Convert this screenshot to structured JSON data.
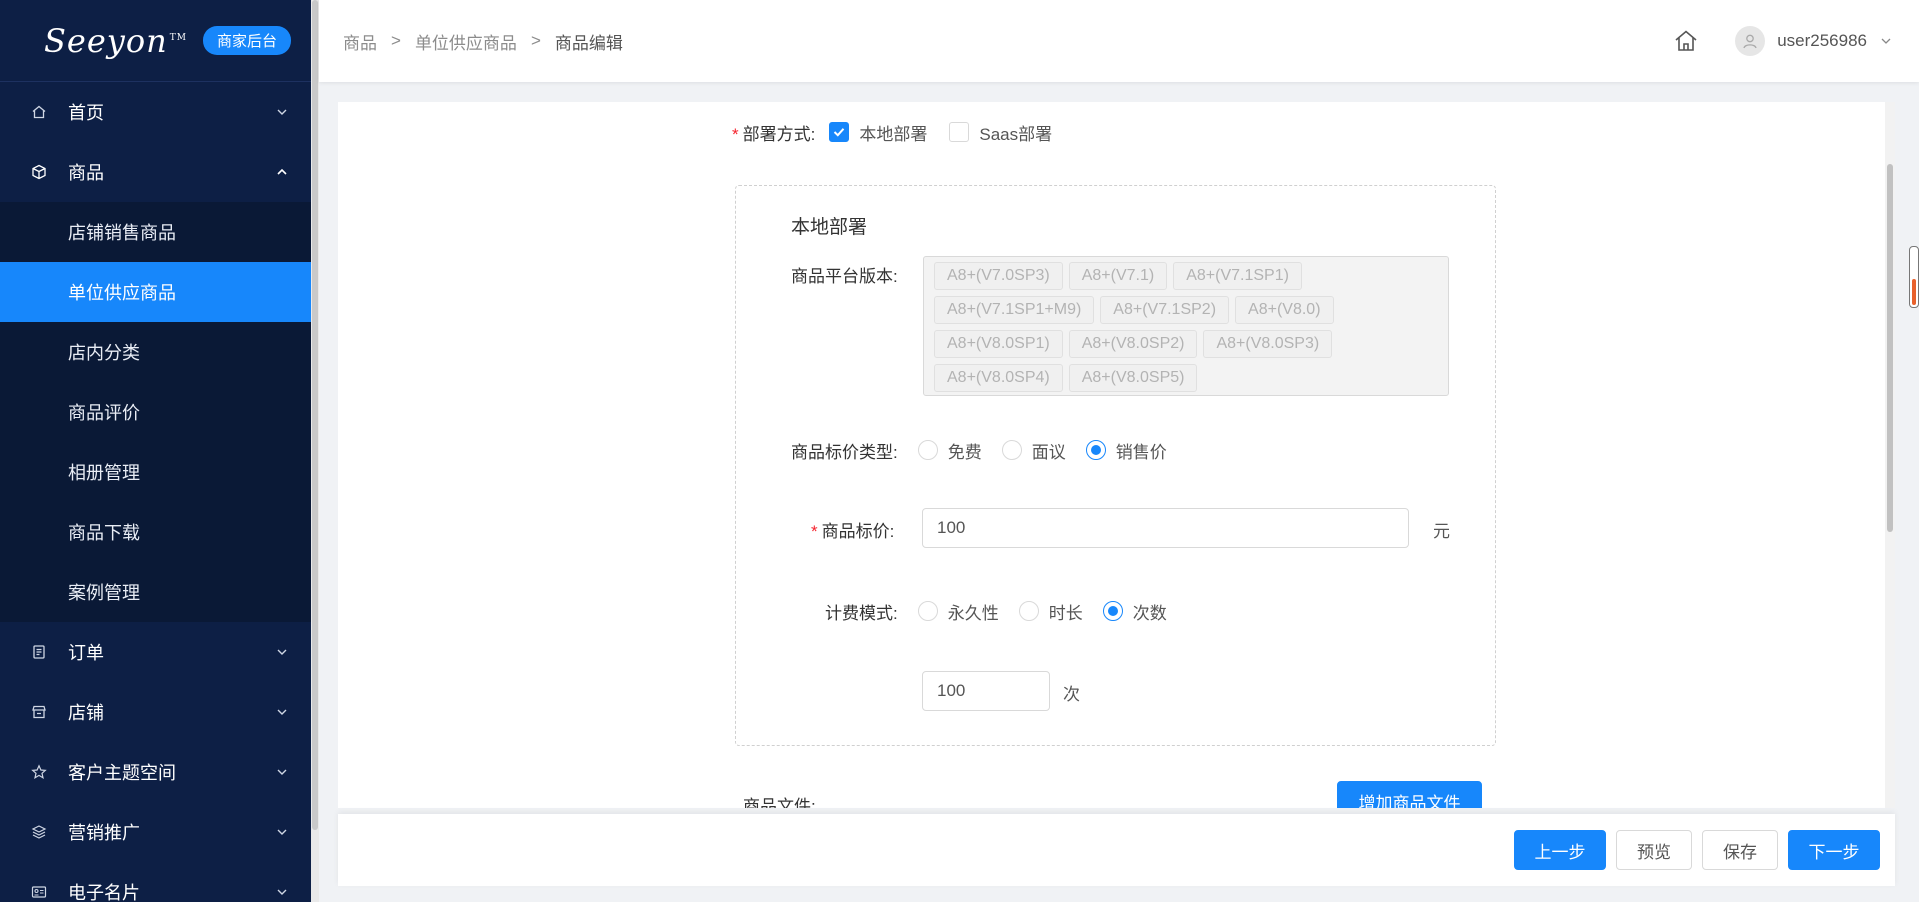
{
  "logo": {
    "text": "Seeyon",
    "tm": "TM",
    "badge": "商家后台"
  },
  "sidebar": {
    "items": [
      {
        "label": "首页",
        "icon": "home-icon"
      },
      {
        "label": "商品",
        "icon": "cube-icon"
      },
      {
        "label": "订单",
        "icon": "document-icon"
      },
      {
        "label": "店铺",
        "icon": "store-icon"
      },
      {
        "label": "客户主题空间",
        "icon": "star-icon"
      },
      {
        "label": "营销推广",
        "icon": "layers-icon"
      },
      {
        "label": "电子名片",
        "icon": "card-icon"
      }
    ],
    "submenu": [
      {
        "label": "店铺销售商品"
      },
      {
        "label": "单位供应商品"
      },
      {
        "label": "店内分类"
      },
      {
        "label": "商品评价"
      },
      {
        "label": "相册管理"
      },
      {
        "label": "商品下载"
      },
      {
        "label": "案例管理"
      }
    ]
  },
  "breadcrumb": {
    "items": [
      "商品",
      "单位供应商品",
      "商品编辑"
    ],
    "separator": ">"
  },
  "header": {
    "username": "user256986"
  },
  "form": {
    "deploy": {
      "label": "部署方式:",
      "options": [
        {
          "label": "本地部署",
          "checked": true
        },
        {
          "label": "Saas部署",
          "checked": false
        }
      ]
    },
    "local_box_title": "本地部署",
    "platform_version": {
      "label": "商品平台版本:",
      "tags": [
        "A8+(V7.0SP3)",
        "A8+(V7.1)",
        "A8+(V7.1SP1)",
        "A8+(V7.1SP1+M9)",
        "A8+(V7.1SP2)",
        "A8+(V8.0)",
        "A8+(V8.0SP1)",
        "A8+(V8.0SP2)",
        "A8+(V8.0SP3)",
        "A8+(V8.0SP4)",
        "A8+(V8.0SP5)"
      ]
    },
    "price_type": {
      "label": "商品标价类型:",
      "options": [
        {
          "label": "免费",
          "checked": false
        },
        {
          "label": "面议",
          "checked": false
        },
        {
          "label": "销售价",
          "checked": true
        }
      ]
    },
    "price": {
      "label": "商品标价:",
      "value": "100",
      "unit": "元"
    },
    "billing": {
      "label": "计费模式:",
      "options": [
        {
          "label": "永久性",
          "checked": false
        },
        {
          "label": "时长",
          "checked": false
        },
        {
          "label": "次数",
          "checked": true
        }
      ]
    },
    "count": {
      "value": "100",
      "unit": "次"
    },
    "files": {
      "label": "商品文件:",
      "add_button": "增加商品文件"
    }
  },
  "footer": {
    "prev": "上一步",
    "preview": "预览",
    "save": "保存",
    "next": "下一步"
  },
  "colors": {
    "sidebar_bg": "#0d1f45",
    "accent": "#1787fb",
    "required": "#f5222d"
  }
}
